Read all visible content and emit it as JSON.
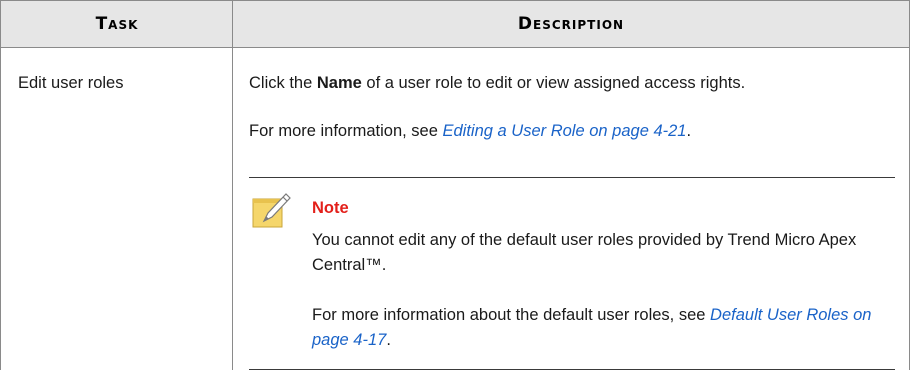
{
  "header": {
    "task_label": "Task",
    "description_label": "Description"
  },
  "row": {
    "task": "Edit user roles",
    "line1_prefix": "Click the ",
    "line1_bold": "Name",
    "line1_suffix": " of a user role to edit or view assigned access rights.",
    "line2_prefix": "For more information, see ",
    "line2_link": "Editing a User Role on page 4-21",
    "line2_suffix": "."
  },
  "note": {
    "icon": "note-pencil-icon",
    "title": "Note",
    "p1": "You cannot edit any of the default user roles provided by Trend Micro Apex Central™.",
    "p2_prefix": "For more information about the default user roles, see ",
    "p2_link": "Default User Roles on page 4-17",
    "p2_suffix": "."
  },
  "colors": {
    "header_bg": "#e6e6e6",
    "link": "#1a63c8",
    "note_title": "#e3201b",
    "note_icon": "#f5d66b"
  }
}
